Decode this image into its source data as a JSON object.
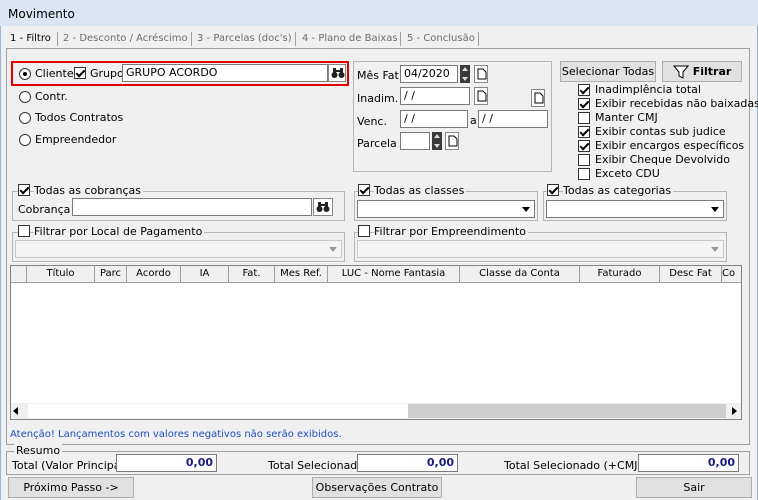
{
  "window": {
    "title": "Movimento"
  },
  "tabs": [
    {
      "label": "1 - Filtro"
    },
    {
      "label": "2 - Desconto / Acréscimo"
    },
    {
      "label": "3 - Parcelas (doc's)"
    },
    {
      "label": "4 - Plano de Baixas"
    },
    {
      "label": "5 - Conclusão"
    }
  ],
  "filter": {
    "cliente_label": "Cliente",
    "grupo_label": "Grupo",
    "grupo_value": "GRUPO ACORDO",
    "contr_label": "Contr.",
    "todos_contratos_label": "Todos Contratos",
    "empreendedor_label": "Empreendedor",
    "selected": "cliente"
  },
  "dates": {
    "mes_fat_label": "Mês Fat.",
    "mes_fat_value": "04/2020",
    "inadim_label": "Inadim.",
    "inadim_value": "/ /",
    "venc_label": "Venc.",
    "venc_from": "/ /",
    "venc_a": "a",
    "venc_to": "/ /",
    "parcela_label": "Parcela",
    "parcela_value": ""
  },
  "options": {
    "select_all_label": "Selecionar Todas",
    "filtrar_label": "Filtrar",
    "items": [
      {
        "label": "Inadimplência total",
        "checked": true
      },
      {
        "label": "Exibir recebidas não baixadas",
        "checked": true
      },
      {
        "label": "Manter CMJ",
        "checked": false
      },
      {
        "label": "Exibir contas sub judice",
        "checked": true
      },
      {
        "label": "Exibir encargos específicos",
        "checked": true
      },
      {
        "label": "Exibir Cheque Devolvido",
        "checked": false
      },
      {
        "label": "Exceto CDU",
        "checked": false
      }
    ]
  },
  "cobrancas": {
    "label": "Todas as cobranças",
    "field_label": "Cobrança",
    "value": "",
    "checked": true
  },
  "classes": {
    "label": "Todas as classes",
    "checked": true
  },
  "categorias": {
    "label": "Todas as categorias",
    "checked": true
  },
  "local_pagamento": {
    "label": "Filtrar por Local de Pagamento",
    "checked": false
  },
  "empreendimento": {
    "label": "Filtrar por Empreendimento",
    "checked": false
  },
  "grid": {
    "columns": [
      "Título",
      "Parc",
      "Acordo",
      "IA",
      "Fat.",
      "Mes Ref.",
      "LUC - Nome Fantasia",
      "Classe da Conta",
      "Faturado",
      "Desc Fat",
      "Co"
    ],
    "rows": []
  },
  "warning": "Atenção! Lançamentos com valores negativos não serão exibidos.",
  "resumo": {
    "title": "Resumo",
    "total_label": "Total (Valor Principal)",
    "total_value": "0,00",
    "selecionado_label": "Total Selecionado",
    "selecionado_value": "0,00",
    "selecionado_cmjd_label": "Total Selecionado (+CMJD)",
    "selecionado_cmjd_value": "0,00"
  },
  "footer": {
    "next_label": "Próximo Passo ->",
    "obs_label": "Observações Contrato",
    "exit_label": "Sair"
  },
  "colors": {
    "highlight": "#e00000",
    "warning_text": "#1f4fbf",
    "window_bg": "#f0f0f0"
  }
}
